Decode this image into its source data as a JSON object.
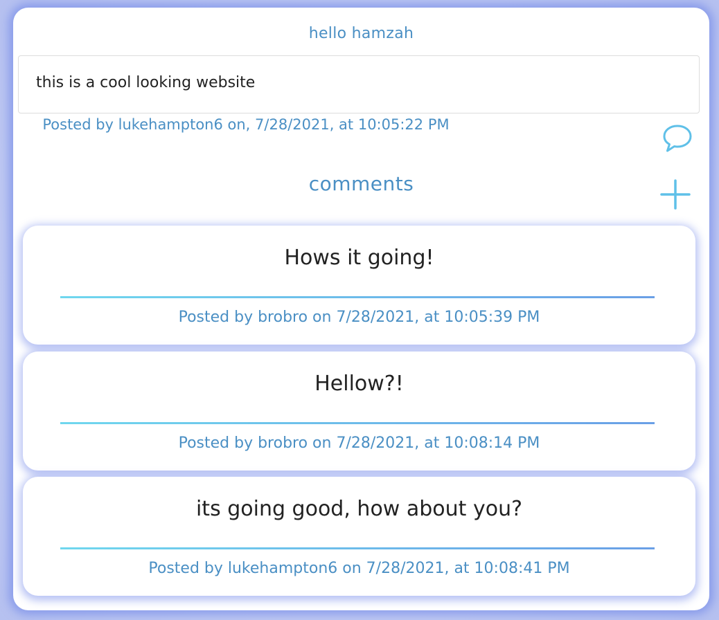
{
  "post": {
    "title": "hello hamzah",
    "body": "this is a cool looking website",
    "meta": "Posted by lukehampton6 on, 7/28/2021, at 10:05:22 PM"
  },
  "comments_heading": "comments",
  "icons": {
    "comment": "speech-bubble-icon",
    "add": "plus-icon"
  },
  "colors": {
    "accent": "#4a8fc4",
    "icon": "#5fc0e8",
    "divider_start": "#6fd7ee",
    "divider_end": "#6a9fe6",
    "glow": "#5f78e6"
  },
  "comments": [
    {
      "text": "Hows it going!",
      "meta": "Posted by brobro on 7/28/2021, at 10:05:39 PM"
    },
    {
      "text": "Hellow?!",
      "meta": "Posted by brobro on 7/28/2021, at 10:08:14 PM"
    },
    {
      "text": "its going good, how about you?",
      "meta": "Posted by lukehampton6 on 7/28/2021, at 10:08:41 PM"
    }
  ]
}
